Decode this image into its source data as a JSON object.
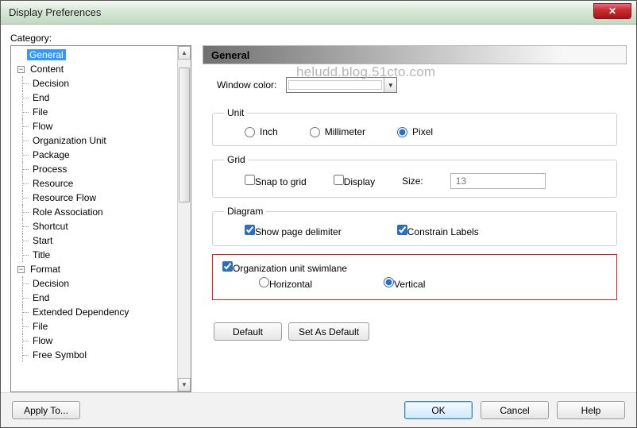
{
  "window": {
    "title": "Display Preferences"
  },
  "category_label": "Category:",
  "tree": {
    "general": "General",
    "content": "Content",
    "content_items": [
      "Decision",
      "End",
      "File",
      "Flow",
      "Organization Unit",
      "Package",
      "Process",
      "Resource",
      "Resource Flow",
      "Role Association",
      "Shortcut",
      "Start",
      "Title"
    ],
    "format": "Format",
    "format_items": [
      "Decision",
      "End",
      "Extended Dependency",
      "File",
      "Flow",
      "Free Symbol"
    ]
  },
  "panel": {
    "heading": "General",
    "window_color_label": "Window color:",
    "unit": {
      "legend": "Unit",
      "inch": "Inch",
      "millimeter": "Millimeter",
      "pixel": "Pixel",
      "selected": "pixel"
    },
    "grid": {
      "legend": "Grid",
      "snap": "Snap to grid",
      "display": "Display",
      "size_label": "Size:",
      "size_value": "13"
    },
    "diagram": {
      "legend": "Diagram",
      "show_page_delimiter": "Show page delimiter",
      "constrain_labels": "Constrain Labels"
    },
    "swimlane": {
      "label": "Organization unit swimlane",
      "horizontal": "Horizontal",
      "vertical": "Vertical",
      "selected": "vertical"
    },
    "default_btn": "Default",
    "set_default_btn": "Set As Default"
  },
  "buttons": {
    "apply_to": "Apply To...",
    "ok": "OK",
    "cancel": "Cancel",
    "help": "Help"
  },
  "watermark": "heludd.blog.51cto.com"
}
